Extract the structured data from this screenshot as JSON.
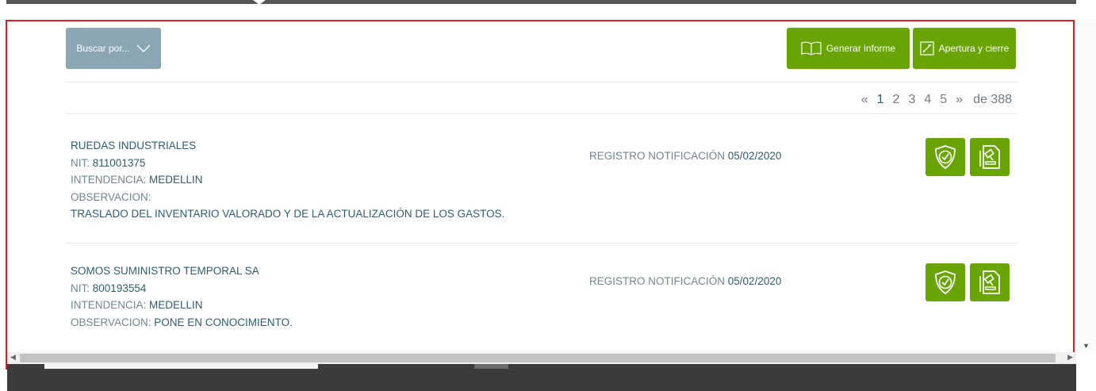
{
  "toolbar": {
    "search_label": "Buscar por...",
    "report_label": "Generar informe",
    "open_close_label": "Apertura y cierre"
  },
  "pagination": {
    "prev": "«",
    "pages": [
      "1",
      "2",
      "3",
      "4",
      "5"
    ],
    "current": "1",
    "next": "»",
    "of_label": "de 388"
  },
  "records": [
    {
      "name": "RUEDAS INDUSTRIALES",
      "nit_label": "NIT:",
      "nit": "811001375",
      "intendencia_label": "INTENDENCIA:",
      "intendencia": "MEDELLIN",
      "obs_label": "OBSERVACION:",
      "observacion": "TRASLADO DEL INVENTARIO VALORADO Y DE LA ACTUALIZACIÓN DE LOS GASTOS.",
      "registro_label": "REGISTRO NOTIFICACIÓN",
      "registro_fecha": "05/02/2020"
    },
    {
      "name": "SOMOS SUMINISTRO TEMPORAL SA",
      "nit_label": "NIT:",
      "nit": "800193554",
      "intendencia_label": "INTENDENCIA:",
      "intendencia": "MEDELLIN",
      "obs_label": "OBSERVACION:",
      "observacion": "PONE EN CONOCIMIENTO.",
      "registro_label": "REGISTRO NOTIFICACIÓN",
      "registro_fecha": "05/02/2020"
    }
  ],
  "icons": {
    "search_caret": "chevron-down-icon",
    "report": "book-icon",
    "open_close": "square-slash-icon",
    "verify": "shield-check-icon",
    "document": "document-gavel-icon"
  },
  "colors": {
    "primary_green": "#6aa304",
    "search_blue_gray": "#8aa6b2",
    "text_blue": "#2f5b70",
    "label_gray": "#73858c",
    "frame_red": "#e01b24"
  }
}
